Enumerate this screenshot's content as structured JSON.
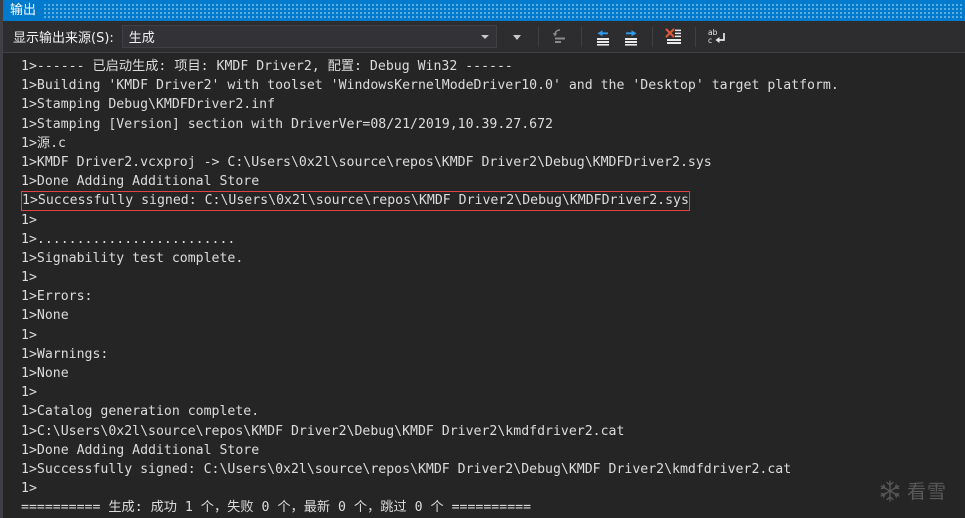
{
  "window": {
    "title": "输出"
  },
  "toolbar": {
    "source_label": "显示输出来源(S):",
    "source_value": "生成",
    "buttons": [
      {
        "name": "clear-pane-icon",
        "tooltip": ""
      },
      {
        "name": "navigate-back-icon",
        "tooltip": ""
      },
      {
        "name": "navigate-forward-icon",
        "tooltip": ""
      },
      {
        "name": "clear-all-icon",
        "tooltip": ""
      },
      {
        "name": "toggle-word-wrap-icon",
        "tooltip": ""
      }
    ]
  },
  "output": {
    "lines": [
      {
        "text": "1>------ 已启动生成: 项目: KMDF Driver2, 配置: Debug Win32 ------",
        "highlight": false
      },
      {
        "text": "1>Building 'KMDF Driver2' with toolset 'WindowsKernelModeDriver10.0' and the 'Desktop' target platform.",
        "highlight": false
      },
      {
        "text": "1>Stamping Debug\\KMDFDriver2.inf",
        "highlight": false
      },
      {
        "text": "1>Stamping [Version] section with DriverVer=08/21/2019,10.39.27.672",
        "highlight": false
      },
      {
        "text": "1>源.c",
        "highlight": false
      },
      {
        "text": "1>KMDF Driver2.vcxproj -> C:\\Users\\0x2l\\source\\repos\\KMDF Driver2\\Debug\\KMDFDriver2.sys",
        "highlight": false
      },
      {
        "text": "1>Done Adding Additional Store",
        "highlight": false
      },
      {
        "text": "1>Successfully signed: C:\\Users\\0x2l\\source\\repos\\KMDF Driver2\\Debug\\KMDFDriver2.sys",
        "highlight": true
      },
      {
        "text": "1>",
        "highlight": false
      },
      {
        "text": "1>.........................",
        "highlight": false
      },
      {
        "text": "1>Signability test complete.",
        "highlight": false
      },
      {
        "text": "1>",
        "highlight": false
      },
      {
        "text": "1>Errors:",
        "highlight": false
      },
      {
        "text": "1>None",
        "highlight": false
      },
      {
        "text": "1>",
        "highlight": false
      },
      {
        "text": "1>Warnings:",
        "highlight": false
      },
      {
        "text": "1>None",
        "highlight": false
      },
      {
        "text": "1>",
        "highlight": false
      },
      {
        "text": "1>Catalog generation complete.",
        "highlight": false
      },
      {
        "text": "1>C:\\Users\\0x2l\\source\\repos\\KMDF Driver2\\Debug\\KMDF Driver2\\kmdfdriver2.cat",
        "highlight": false
      },
      {
        "text": "1>Done Adding Additional Store",
        "highlight": false
      },
      {
        "text": "1>Successfully signed: C:\\Users\\0x2l\\source\\repos\\KMDF Driver2\\Debug\\KMDF Driver2\\kmdfdriver2.cat",
        "highlight": false
      },
      {
        "text": "1>",
        "highlight": false
      },
      {
        "text": "========== 生成: 成功 1 个，失败 0 个，最新 0 个，跳过 0 个 ==========",
        "highlight": false
      }
    ]
  },
  "watermark": {
    "text": "看雪"
  },
  "colors": {
    "title_bar": "#007acc",
    "toolbar": "#2d2d30",
    "output_background": "#252526",
    "text": "#dcdcdc",
    "highlight_border": "#e04343",
    "accent_blue": "#3399ff",
    "accent_red": "#e74a3a"
  }
}
